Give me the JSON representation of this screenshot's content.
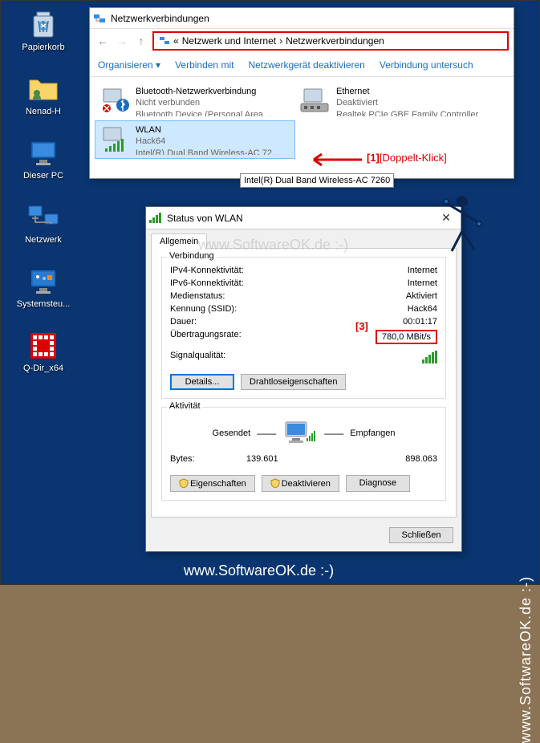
{
  "desktop_icons": {
    "recycle": "Papierkorb",
    "user": "Nenad-H",
    "pc": "Dieser PC",
    "network": "Netzwerk",
    "settings": "Systemsteu...",
    "qdir": "Q-Dir_x64"
  },
  "main_window": {
    "title": "Netzwerkverbindungen",
    "breadcrumb": {
      "part1": "Netzwerk und Internet",
      "part2": "Netzwerkverbindungen"
    },
    "toolbar": {
      "organize": "Organisieren",
      "connect": "Verbinden mit",
      "disable": "Netzwerkgerät deaktivieren",
      "diagnose": "Verbindung untersuch"
    },
    "connections": {
      "bt": {
        "name": "Bluetooth-Netzwerkverbindung",
        "status": "Nicht verbunden",
        "adapter": "Bluetooth Device (Personal Area ..."
      },
      "eth": {
        "name": "Ethernet",
        "status": "Deaktiviert",
        "adapter": "Realtek PCIe GBE Family Controller"
      },
      "wlan": {
        "name": "WLAN",
        "status": "Hack64",
        "adapter": "Intel(R) Dual Band Wireless-AC 72..."
      }
    },
    "tooltip": "Intel(R) Dual Band Wireless-AC 7260"
  },
  "status_dialog": {
    "title": "Status von WLAN",
    "tab": "Allgemein",
    "section_connection": "Verbindung",
    "props": {
      "ipv4k": "IPv4-Konnektivität:",
      "ipv4v": "Internet",
      "ipv6k": "IPv6-Konnektivität:",
      "ipv6v": "Internet",
      "mediak": "Medienstatus:",
      "mediav": "Aktiviert",
      "ssidk": "Kennung (SSID):",
      "ssidv": "Hack64",
      "durk": "Dauer:",
      "durv": "00:01:17",
      "ratek": "Übertragungsrate:",
      "ratev": "780,0 MBit/s",
      "sigk": "Signalqualität:"
    },
    "buttons": {
      "details": "Details...",
      "wireless_props": "Drahtloseigenschaften",
      "properties": "Eigenschaften",
      "disable": "Deaktivieren",
      "diagnose": "Diagnose",
      "close": "Schließen"
    },
    "section_activity": "Aktivität",
    "activity": {
      "sent": "Gesendet",
      "received": "Empfangen",
      "bytes_label": "Bytes:",
      "bytes_sent": "139.601",
      "bytes_recv": "898.063"
    }
  },
  "annotations": {
    "a1_num": "[1]",
    "a1_text": "[Doppelt-Klick]",
    "a3_num": "[3]"
  },
  "watermark": "www.SoftwareOK.de :-)"
}
